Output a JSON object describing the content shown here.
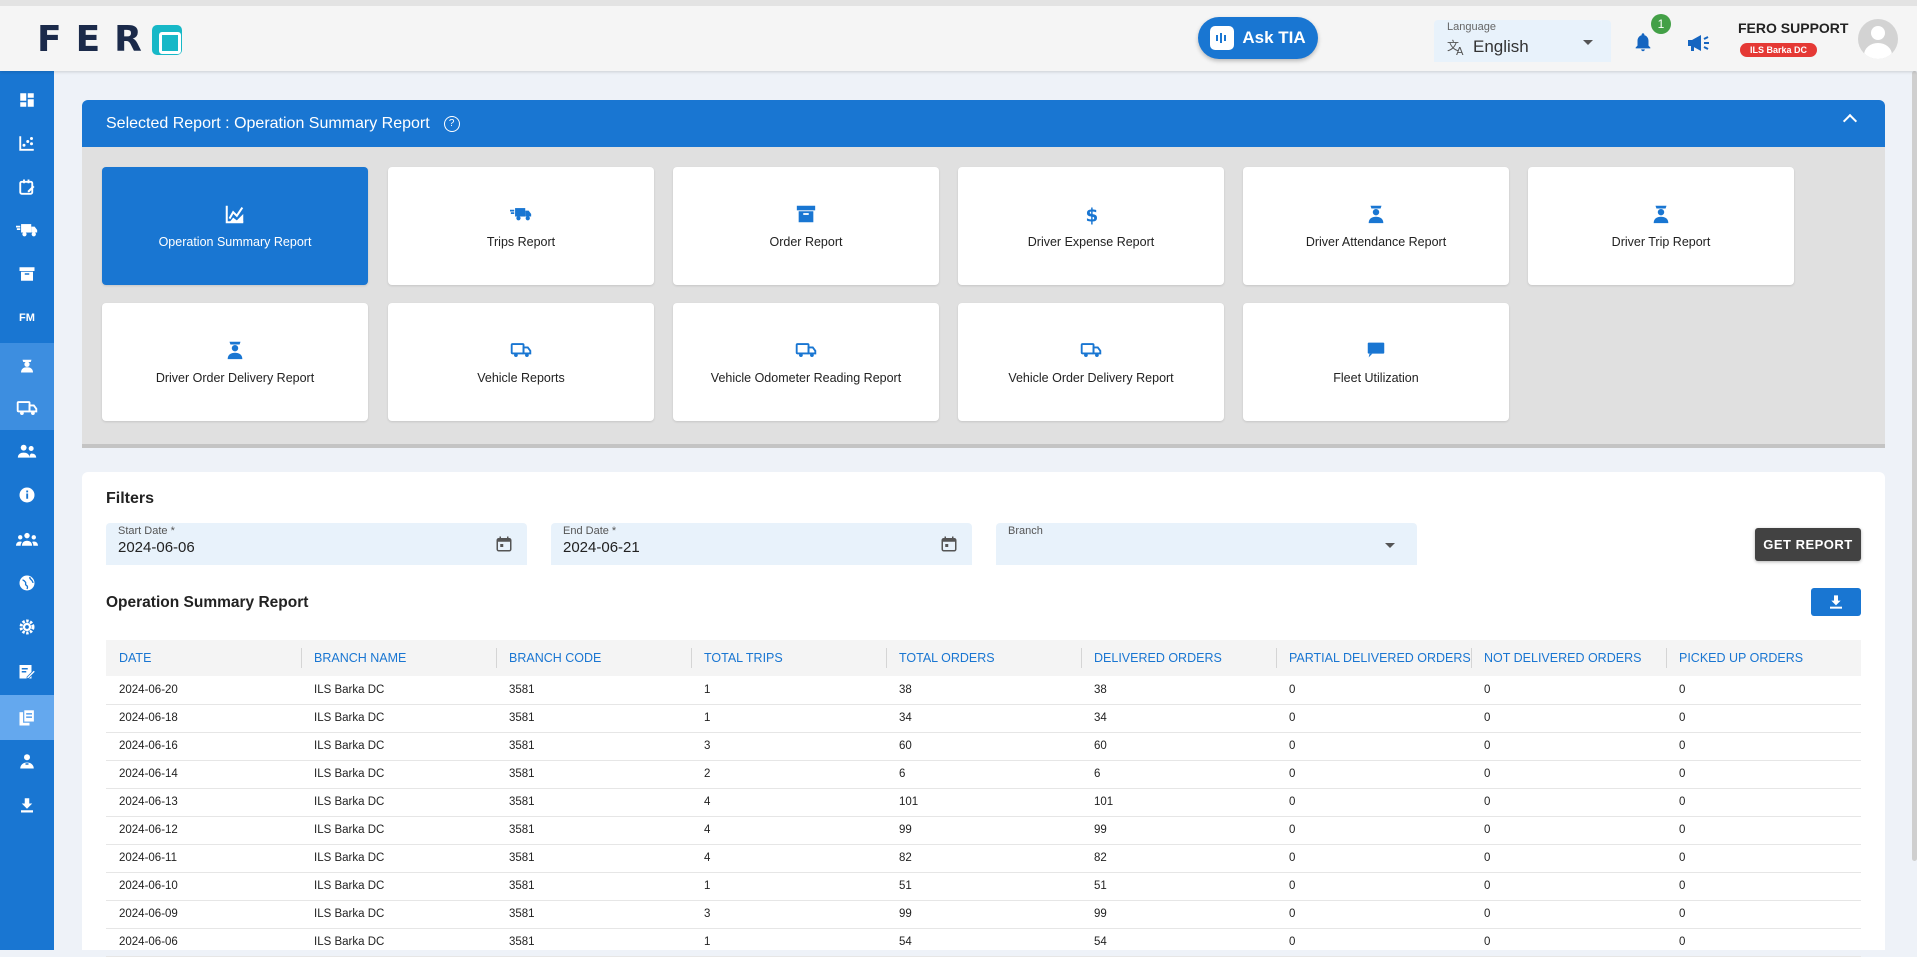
{
  "header": {
    "logo": "FER",
    "ask_tia": "Ask TIA",
    "language_label": "Language",
    "language_value": "English",
    "notification_count": "1",
    "user_name": "FERO SUPPORT",
    "user_branch": "ILS Barka DC"
  },
  "sidebar": {
    "items": [
      "dashboard-icon",
      "analytics-icon",
      "schedule-icon",
      "truck-icon",
      "archive-icon",
      "FM",
      "driver-icon",
      "vehicle-icon",
      "users-icon",
      "info-icon",
      "team-icon",
      "globe-icon",
      "settings-icon",
      "edit-icon",
      "reports-icon",
      "person-icon",
      "download-icon"
    ],
    "fm_label": "FM"
  },
  "report_panel": {
    "title": "Selected Report : Operation Summary Report",
    "help": "?",
    "cards": [
      {
        "label": "Operation Summary Report",
        "icon": "chart-icon",
        "selected": true
      },
      {
        "label": "Trips Report",
        "icon": "truck-fast-icon",
        "selected": false
      },
      {
        "label": "Order Report",
        "icon": "archive-icon",
        "selected": false
      },
      {
        "label": "Driver Expense Report",
        "icon": "dollar-icon",
        "selected": false
      },
      {
        "label": "Driver Attendance Report",
        "icon": "driver-icon",
        "selected": false
      },
      {
        "label": "Driver Trip Report",
        "icon": "driver-icon",
        "selected": false
      },
      {
        "label": "Driver Order Delivery Report",
        "icon": "driver-icon",
        "selected": false
      },
      {
        "label": "Vehicle Reports",
        "icon": "truck-icon",
        "selected": false
      },
      {
        "label": "Vehicle Odometer Reading Report",
        "icon": "truck-icon",
        "selected": false
      },
      {
        "label": "Vehicle Order Delivery Report",
        "icon": "truck-icon",
        "selected": false
      },
      {
        "label": "Fleet Utilization",
        "icon": "fleet-icon",
        "selected": false
      }
    ]
  },
  "filters": {
    "title": "Filters",
    "start_date_label": "Start Date *",
    "start_date_value": "2024-06-06",
    "end_date_label": "End Date *",
    "end_date_value": "2024-06-21",
    "branch_label": "Branch",
    "branch_value": "",
    "get_report": "GET REPORT"
  },
  "table": {
    "title": "Operation Summary Report",
    "columns": [
      "DATE",
      "BRANCH NAME",
      "BRANCH CODE",
      "TOTAL TRIPS",
      "TOTAL ORDERS",
      "DELIVERED ORDERS",
      "PARTIAL DELIVERED ORDERS",
      "NOT DELIVERED ORDERS",
      "PICKED UP ORDERS"
    ],
    "rows": [
      [
        "2024-06-20",
        "ILS Barka DC",
        "3581",
        "1",
        "38",
        "38",
        "0",
        "0",
        "0"
      ],
      [
        "2024-06-18",
        "ILS Barka DC",
        "3581",
        "1",
        "34",
        "34",
        "0",
        "0",
        "0"
      ],
      [
        "2024-06-16",
        "ILS Barka DC",
        "3581",
        "3",
        "60",
        "60",
        "0",
        "0",
        "0"
      ],
      [
        "2024-06-14",
        "ILS Barka DC",
        "3581",
        "2",
        "6",
        "6",
        "0",
        "0",
        "0"
      ],
      [
        "2024-06-13",
        "ILS Barka DC",
        "3581",
        "4",
        "101",
        "101",
        "0",
        "0",
        "0"
      ],
      [
        "2024-06-12",
        "ILS Barka DC",
        "3581",
        "4",
        "99",
        "99",
        "0",
        "0",
        "0"
      ],
      [
        "2024-06-11",
        "ILS Barka DC",
        "3581",
        "4",
        "82",
        "82",
        "0",
        "0",
        "0"
      ],
      [
        "2024-06-10",
        "ILS Barka DC",
        "3581",
        "1",
        "51",
        "51",
        "0",
        "0",
        "0"
      ],
      [
        "2024-06-09",
        "ILS Barka DC",
        "3581",
        "3",
        "99",
        "99",
        "0",
        "0",
        "0"
      ],
      [
        "2024-06-06",
        "ILS Barka DC",
        "3581",
        "1",
        "54",
        "54",
        "0",
        "0",
        "0"
      ]
    ]
  },
  "colors": {
    "primary": "#1976d2",
    "badge_green": "#43a047",
    "branch_red": "#e53935",
    "dark_button": "#424242"
  }
}
